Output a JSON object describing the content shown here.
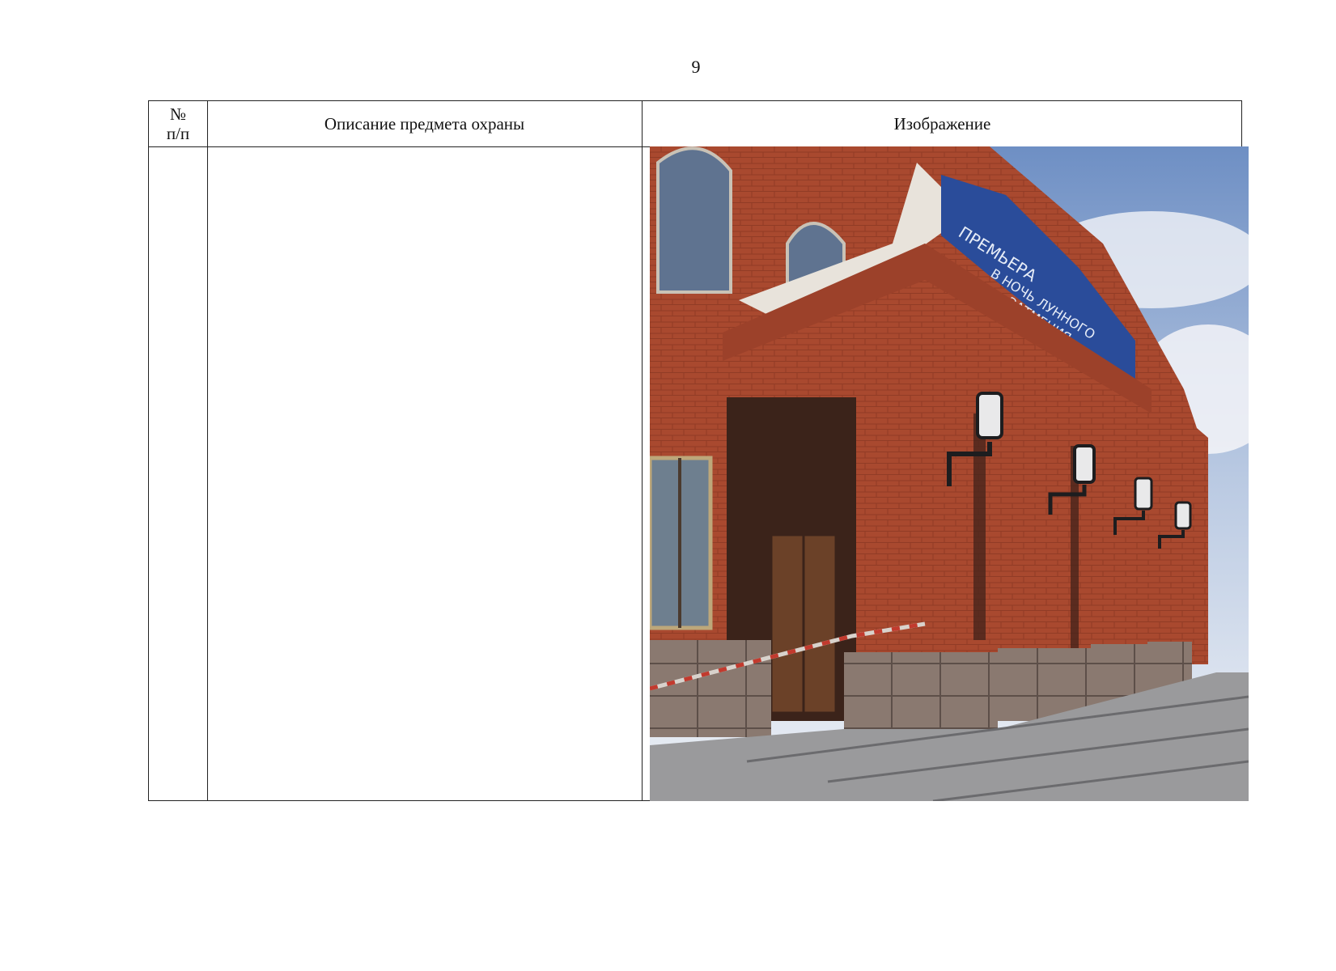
{
  "page": {
    "number": "9"
  },
  "table": {
    "headers": {
      "number_symbol": "№",
      "number_sub": "п/п",
      "description": "Описание предмета охраны",
      "image": "Изображение"
    }
  },
  "photo": {
    "description": "Photograph of a red-brick building facade corner with arched windows, pilasters, wall lanterns, granite base and steps",
    "banner_lines": [
      "ПРЕМЬЕРА",
      "В НОЧЬ ЛУННОГО",
      "ЗАТМЕНИЯ"
    ],
    "colors": {
      "brick": "#a8472e",
      "sky": "#9fb6d6",
      "granite": "#8d7b72",
      "banner": "#2a4c9a"
    }
  }
}
